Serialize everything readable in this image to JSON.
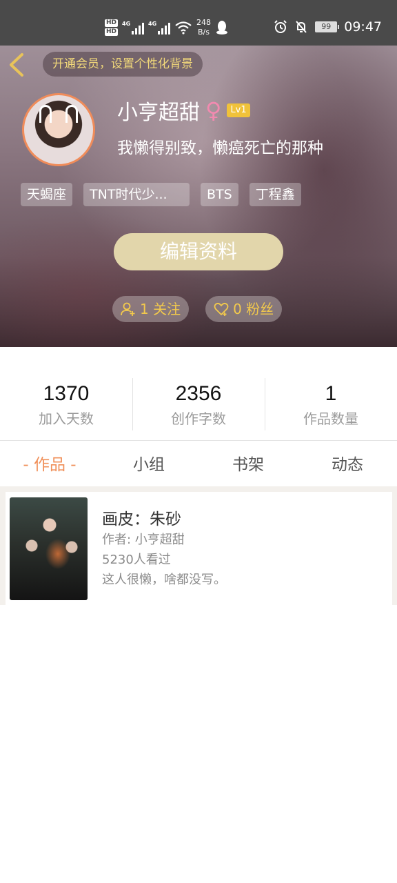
{
  "status_bar": {
    "hd1": "HD",
    "hd2": "HD",
    "net1": "4G",
    "net2": "4G",
    "speed_value": "248",
    "speed_unit": "B/s",
    "battery": "99",
    "time": "09:47",
    "icons": [
      "qq-icon",
      "alarm-icon",
      "mute-bell-icon",
      "battery-icon",
      "wifi-icon"
    ]
  },
  "header": {
    "vip_prompt": "开通会员，设置个性化背景",
    "username": "小亨超甜",
    "gender_symbol": "♀",
    "level": "Lv1",
    "signature": "我懒得别致，懒癌死亡的那种",
    "tags": [
      "天蝎座",
      "TNT时代少...",
      "BTS",
      "丁程鑫"
    ],
    "edit_button": "编辑资料",
    "following": "1 关注",
    "followers": "0 粉丝"
  },
  "stats": [
    {
      "value": "1370",
      "label": "加入天数"
    },
    {
      "value": "2356",
      "label": "创作字数"
    },
    {
      "value": "1",
      "label": "作品数量"
    }
  ],
  "tabs": [
    "- 作品 -",
    "小组",
    "书架",
    "动态"
  ],
  "works": [
    {
      "title": "画皮：朱砂",
      "author": "作者: 小亨超甜",
      "views": "5230人看过",
      "description": "这人很懒，啥都没写。"
    }
  ],
  "colors": {
    "accent": "#f0905a",
    "gold": "#f2c94c",
    "edit_button": "#e2d6ab",
    "status_bar": "#4a4a4a"
  }
}
